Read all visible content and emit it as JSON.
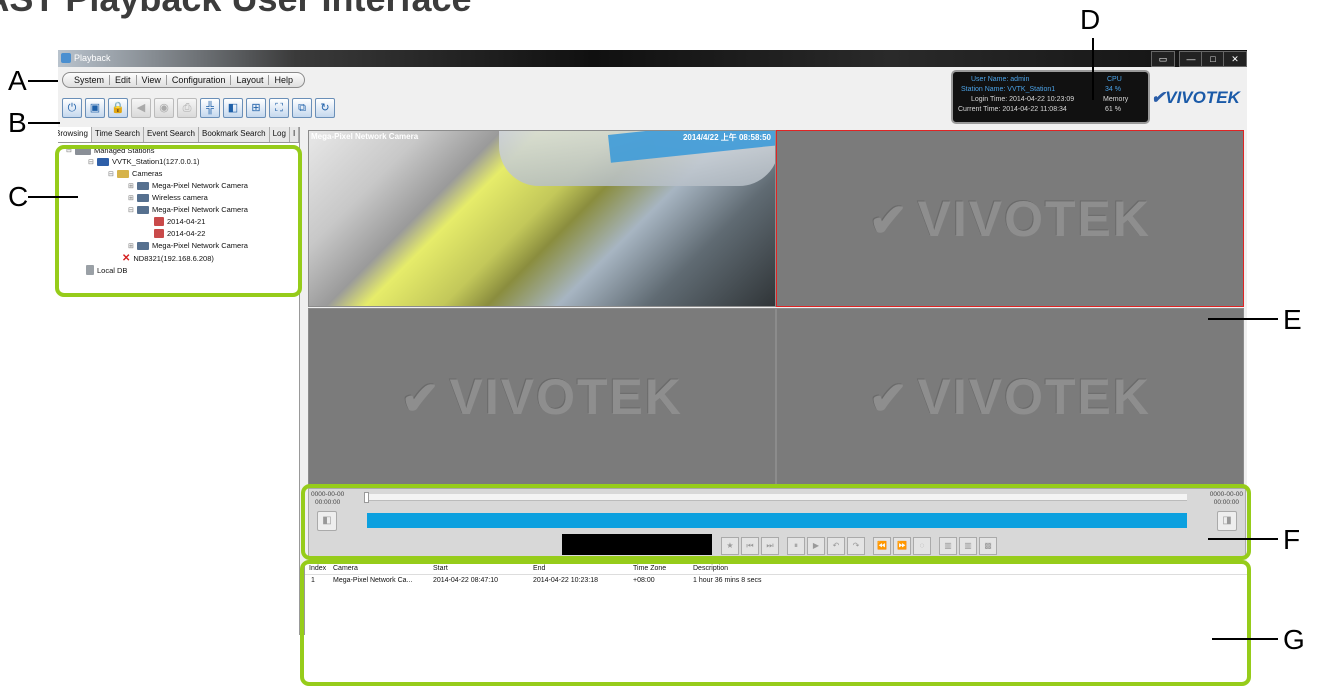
{
  "heading": "VAST Playback User Interface",
  "callouts": [
    "A",
    "B",
    "C",
    "D",
    "E",
    "F",
    "G"
  ],
  "window": {
    "title": "Playback",
    "controls": [
      "▭",
      "—",
      "□",
      "✕"
    ]
  },
  "menu": [
    "System",
    "Edit",
    "View",
    "Configuration",
    "Layout",
    "Help"
  ],
  "toolbar_icons": [
    {
      "name": "power-icon",
      "glyph": "⏻",
      "disabled": false
    },
    {
      "name": "monitor-icon",
      "glyph": "▣",
      "disabled": false
    },
    {
      "name": "lock-icon",
      "glyph": "🔒",
      "disabled": false
    },
    {
      "name": "speaker-icon",
      "glyph": "◀",
      "disabled": true
    },
    {
      "name": "snapshot-icon",
      "glyph": "◉",
      "disabled": true
    },
    {
      "name": "print-icon",
      "glyph": "⎙",
      "disabled": true
    },
    {
      "name": "dewarp-icon",
      "glyph": "╬",
      "disabled": false
    },
    {
      "name": "camera-icon",
      "glyph": "◧",
      "disabled": false
    },
    {
      "name": "layout-grid-icon",
      "glyph": "⊞",
      "disabled": false
    },
    {
      "name": "fullscreen-icon",
      "glyph": "⛶",
      "disabled": false
    },
    {
      "name": "sequence-icon",
      "glyph": "⧉",
      "disabled": false
    },
    {
      "name": "refresh-icon",
      "glyph": "↻",
      "disabled": false
    }
  ],
  "info": {
    "user_name": "User Name: admin",
    "station_name": "Station Name: VVTK_Station1",
    "login_time": "Login Time: 2014-04-22 10:23:09",
    "current_time": "Current Time: 2014-04-22 11:08:34",
    "cpu_label": "CPU",
    "cpu_value": "34 %",
    "memory_label": "Memory",
    "memory_value": "61 %"
  },
  "logo": "VIVOTEK",
  "tabs": [
    "Browsing",
    "Time Search",
    "Event Search",
    "Bookmark Search",
    "Log",
    "I"
  ],
  "tree": {
    "managed": "Managed Stations",
    "station": "VVTK_Station1(127.0.0.1)",
    "cameras": "Cameras",
    "cam1": "Mega-Pixel Network Camera",
    "cam2": "Wireless camera",
    "cam3": "Mega-Pixel Network Camera",
    "date1": "2014-04-21",
    "date2": "2014-04-22",
    "cam4": "Mega-Pixel Network Camera",
    "nd": "ND8321(192.168.6.208)",
    "local": "Local DB"
  },
  "video": {
    "overlay_name": "Mega-Pixel Network Camera",
    "overlay_time": "2014/4/22 上午 08:58:50",
    "watermark": "VIVOTEK"
  },
  "timeline": {
    "left_date": "0000-00-00",
    "left_time": "00:00:00",
    "right_date": "0000-00-00",
    "right_time": "00:00:00",
    "controls": [
      "★",
      "⏮",
      "⏭",
      "⏸",
      "▶",
      "↶",
      "↷",
      "⏪",
      "⏩",
      "◌",
      "▥",
      "▥",
      "▩"
    ]
  },
  "list": {
    "headers": [
      "Index",
      "Camera",
      "Start",
      "End",
      "Time Zone",
      "Description"
    ],
    "rows": [
      [
        "1",
        "Mega-Pixel Network Ca...",
        "2014-04-22 08:47:10",
        "2014-04-22 10:23:18",
        "+08:00",
        "1 hour 36 mins 8 secs"
      ]
    ]
  }
}
